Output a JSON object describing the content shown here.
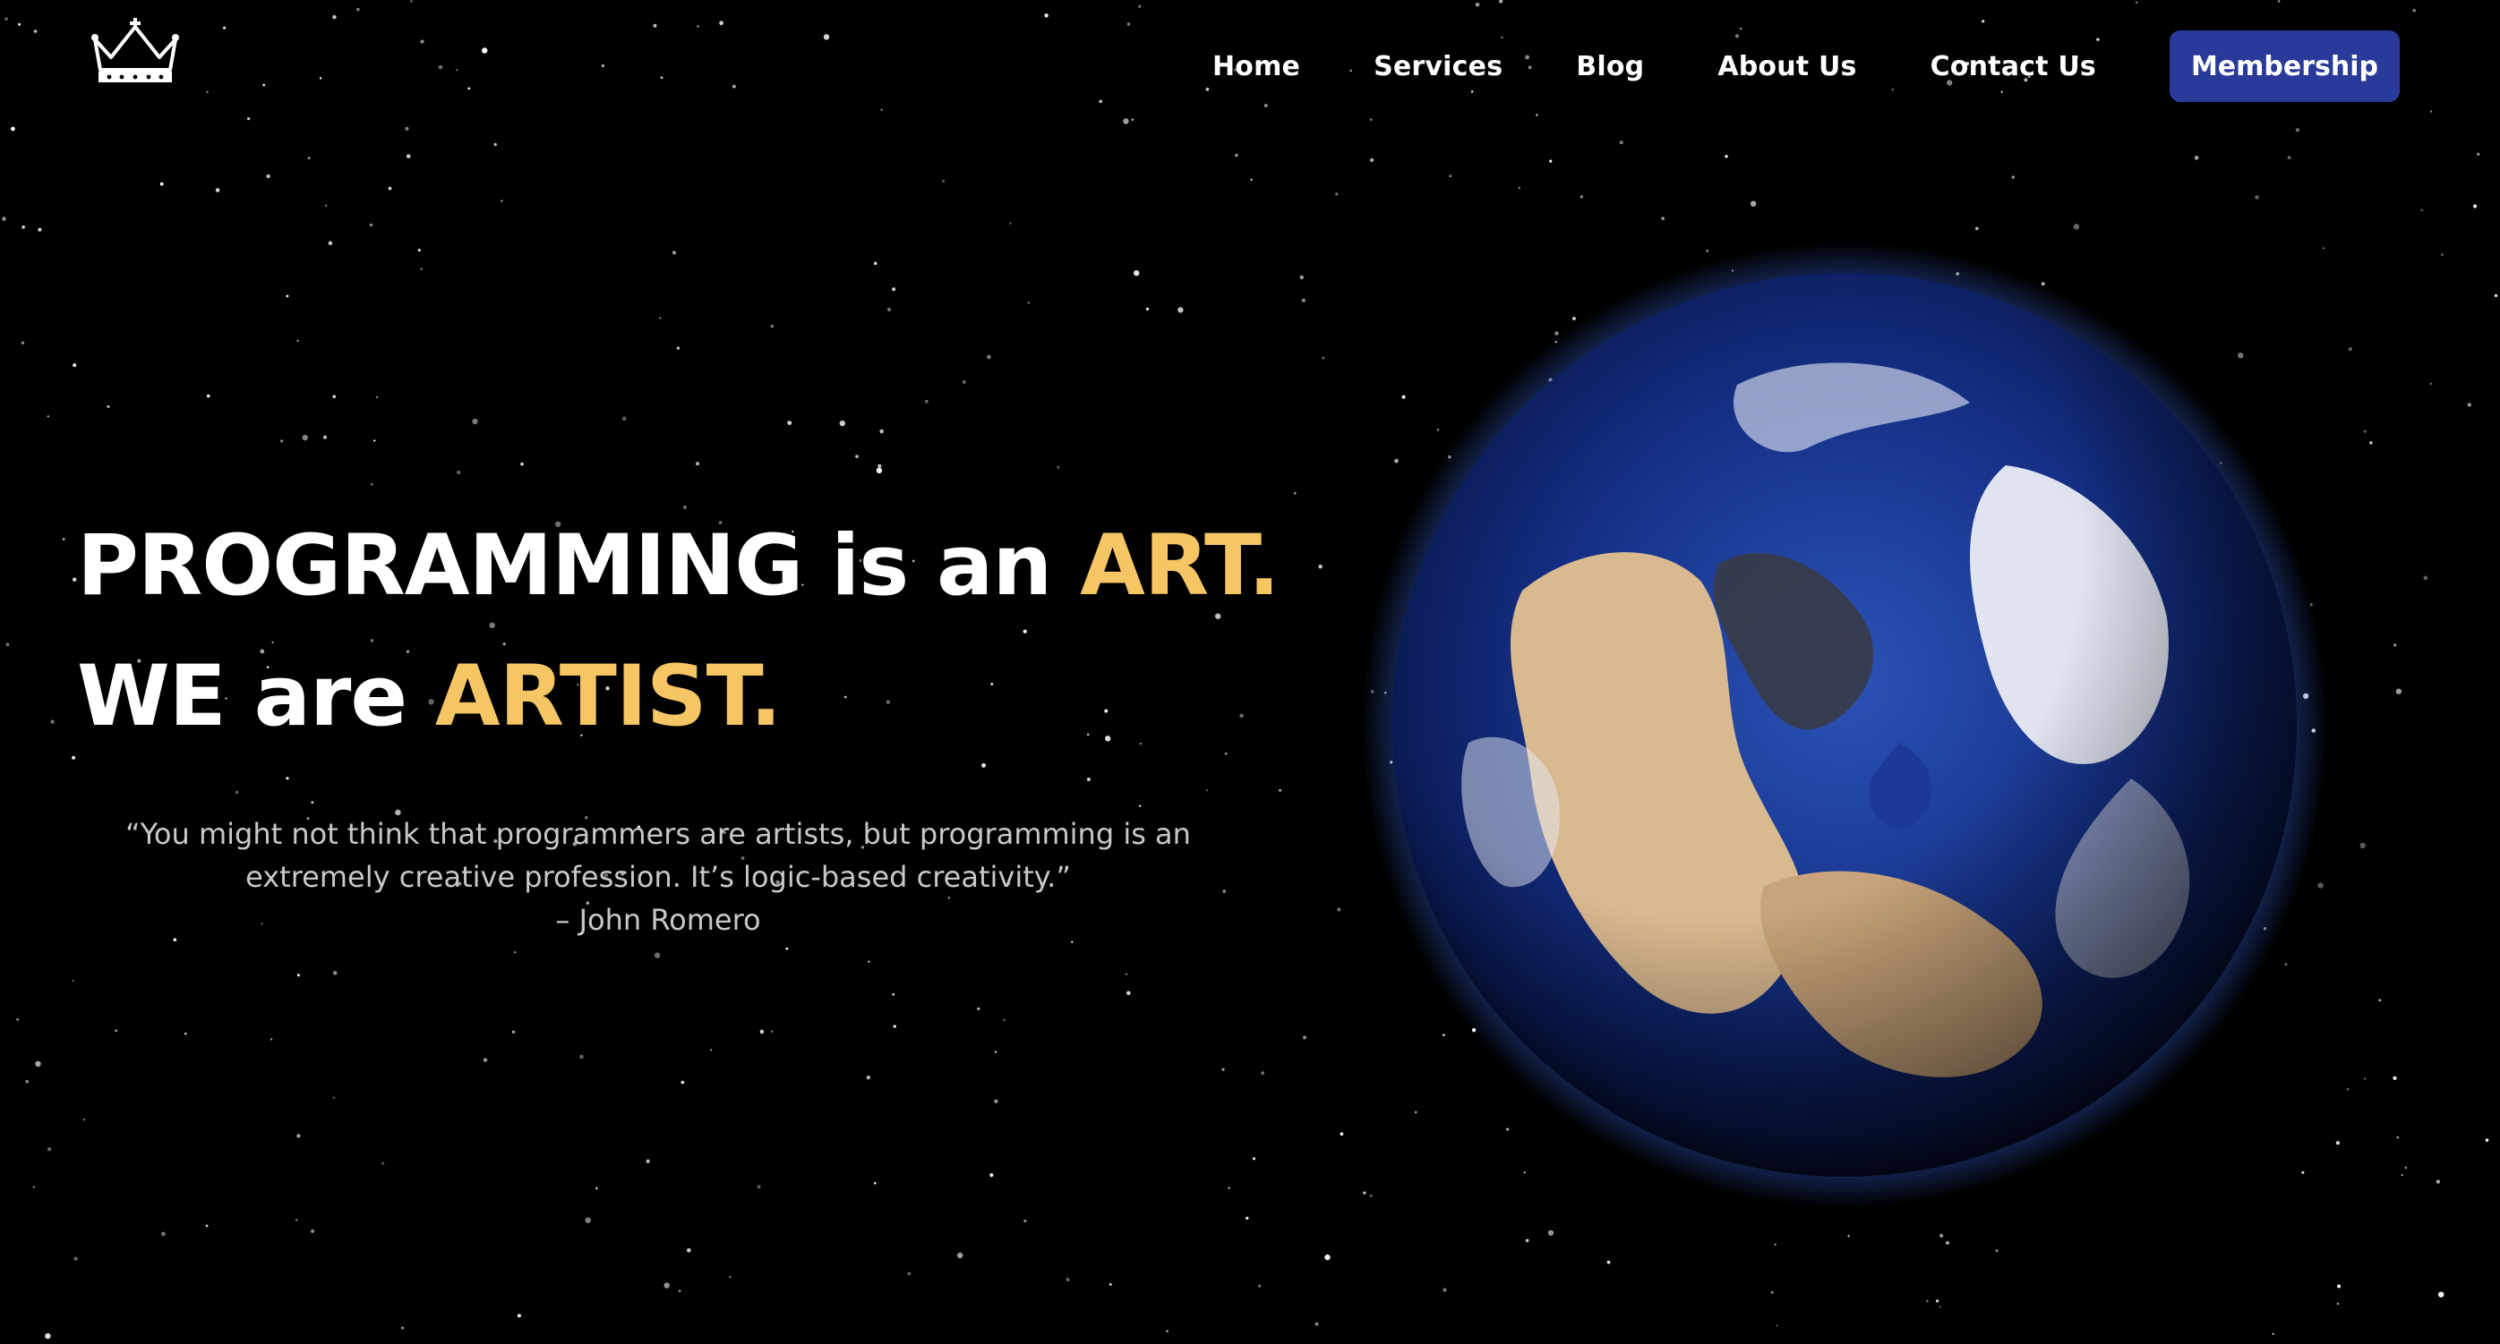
{
  "brand": {
    "logo_icon": "crown-icon"
  },
  "nav": {
    "items": [
      "Home",
      "Services",
      "Blog",
      "About Us",
      "Contact Us"
    ],
    "cta_label": "Membership"
  },
  "hero": {
    "line1_main": "PROGRAMMING is an ",
    "line1_accent": "ART.",
    "line2_main": "WE are ",
    "line2_accent": "ARTIST.",
    "quote_text": "“You might not think that programmers are artists, but programming is an extremely creative profession. It’s logic-based creativity.”",
    "quote_author": "– John Romero"
  },
  "visual": {
    "globe_icon": "earth-globe-icon"
  },
  "colors": {
    "background": "#000000",
    "accent": "#f6c564",
    "button": "#2a3a9b",
    "text": "#ffffff",
    "muted_text": "#c8c8c8"
  }
}
